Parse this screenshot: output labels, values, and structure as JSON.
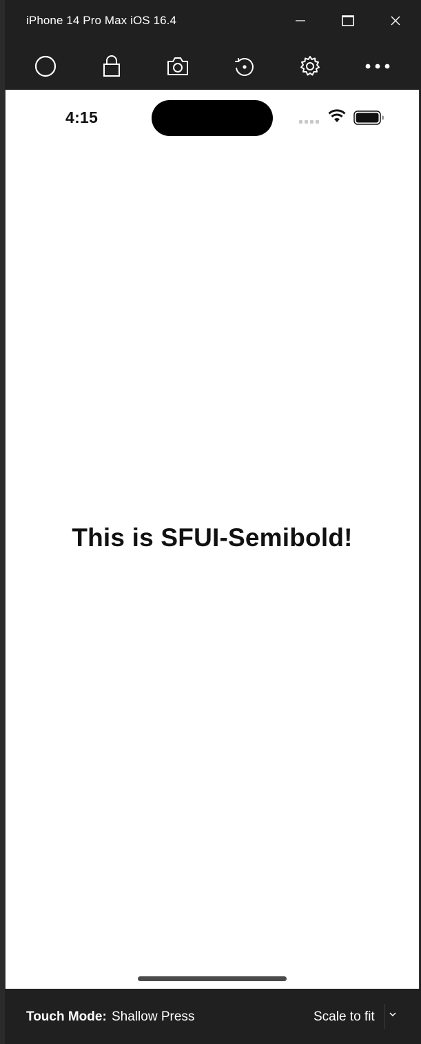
{
  "window": {
    "title": "iPhone 14 Pro Max iOS 16.4"
  },
  "toolbar": {
    "buttons": [
      {
        "name": "home-button",
        "icon": "circle-icon"
      },
      {
        "name": "lock-button",
        "icon": "lock-icon"
      },
      {
        "name": "screenshot-button",
        "icon": "camera-icon"
      },
      {
        "name": "rotate-button",
        "icon": "rotate-icon"
      },
      {
        "name": "settings-button",
        "icon": "gear-icon"
      },
      {
        "name": "more-button",
        "icon": "more-icon"
      }
    ]
  },
  "status_bar": {
    "time": "4:15"
  },
  "app": {
    "message": "This is SFUI-Semibold!"
  },
  "bottom_bar": {
    "touch_mode_label": "Touch Mode:",
    "touch_mode_value": "Shallow Press",
    "scale_value": "Scale to fit"
  },
  "colors": {
    "chrome_background": "#202020",
    "screen_background": "#ffffff",
    "text_dark": "#111111"
  }
}
